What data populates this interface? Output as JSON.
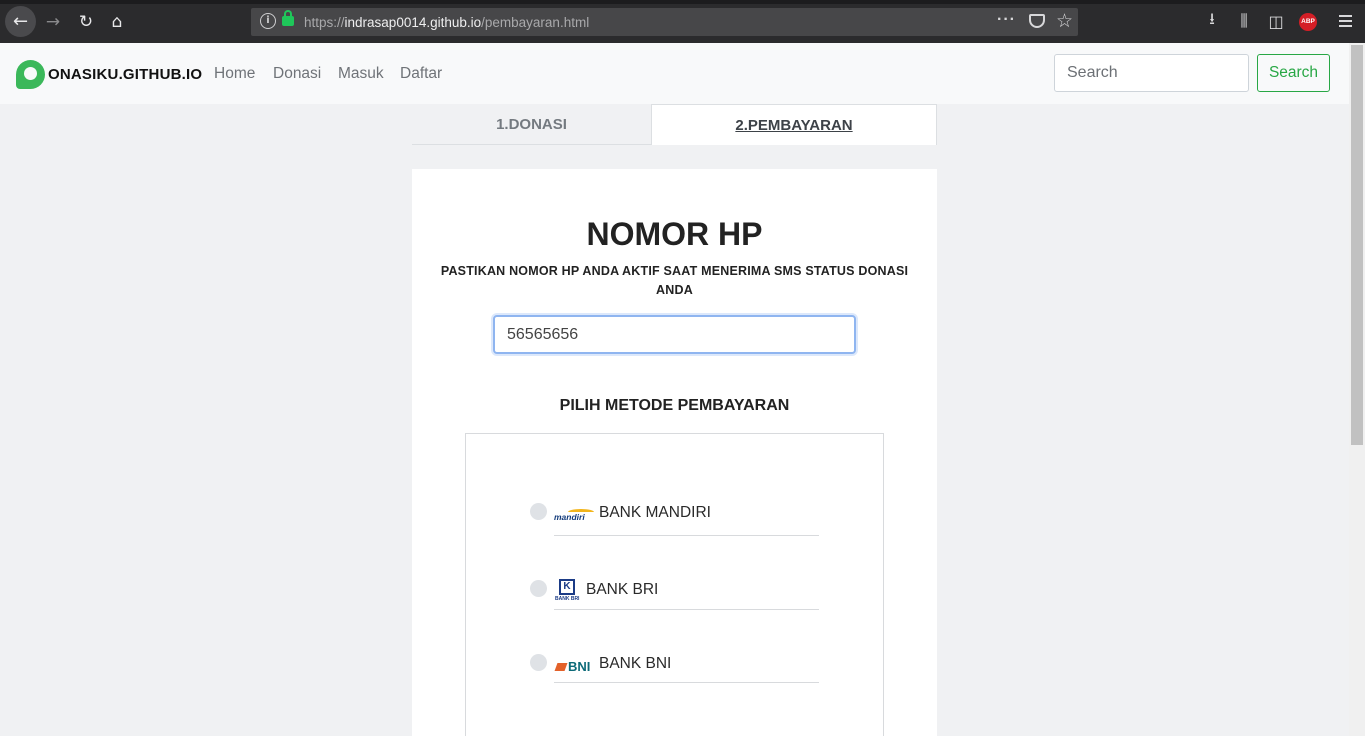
{
  "browser": {
    "url_prefix": "https://",
    "url_host": "indrasap0014.github.io",
    "url_path": "/pembayaran.html",
    "icons": [
      "back-icon",
      "forward-icon",
      "reload-icon",
      "home-icon",
      "info-icon",
      "lock-icon",
      "page-actions-icon",
      "pocket-icon",
      "bookmark-star-icon",
      "download-icon",
      "library-icon",
      "sidebar-icon",
      "adblock-plus-icon",
      "menu-icon"
    ],
    "abp_label": "ABP"
  },
  "navbar": {
    "brand": "ONASIKU.GITHUB.IO",
    "links": [
      "Home",
      "Donasi",
      "Masuk",
      "Daftar"
    ],
    "search_placeholder": "Search",
    "search_button": "Search",
    "accent_color": "#28a745"
  },
  "steps": {
    "step1": "1.DONASI",
    "step2": "2.PEMBAYARAN"
  },
  "card": {
    "title": "NOMOR HP",
    "subtitle": "PASTIKAN NOMOR HP ANDA AKTIF SAAT MENERIMA SMS STATUS DONASI ANDA",
    "phone_value": "56565656",
    "method_title": "PILIH METODE PEMBAYARAN",
    "banks": [
      {
        "name": "BANK MANDIRI",
        "logo": "mandiri"
      },
      {
        "name": "BANK BRI",
        "logo": "BANK BRI"
      },
      {
        "name": "BANK BNI",
        "logo": "BNI"
      }
    ]
  }
}
